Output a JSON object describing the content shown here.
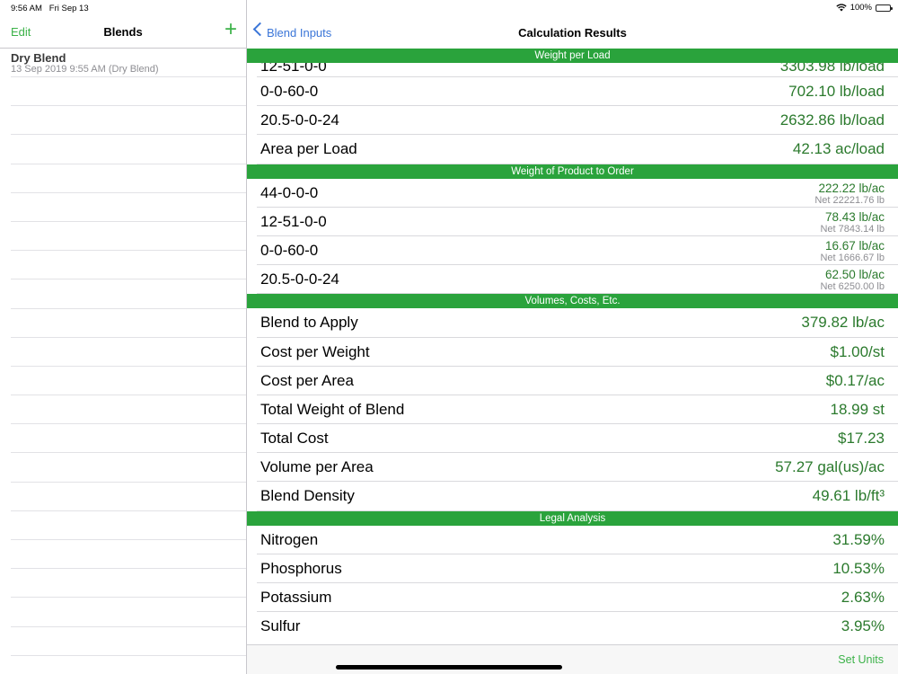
{
  "status": {
    "time": "9:56 AM",
    "date": "Fri Sep 13",
    "battery": "100%"
  },
  "sidebar": {
    "edit_label": "Edit",
    "title": "Blends",
    "add_label": "+",
    "items": [
      {
        "name": "Dry Blend",
        "subtitle": "13 Sep 2019  9:55 AM (Dry Blend)"
      }
    ]
  },
  "detail": {
    "back_label": "Blend Inputs",
    "title": "Calculation Results",
    "toolbar_button": "Set Units"
  },
  "sections": {
    "weight_per_load": {
      "header": "Weight per Load",
      "partial_row": {
        "label": "12-51-0-0",
        "value": "3303.98 lb/load"
      },
      "rows": [
        {
          "label": "0-0-60-0",
          "value": "702.10 lb/load"
        },
        {
          "label": "20.5-0-0-24",
          "value": "2632.86 lb/load"
        },
        {
          "label": "Area per Load",
          "value": "42.13 ac/load"
        }
      ]
    },
    "weight_to_order": {
      "header": "Weight of Product to Order",
      "rows": [
        {
          "label": "44-0-0-0",
          "value": "222.22 lb/ac",
          "net": "Net 22221.76 lb"
        },
        {
          "label": "12-51-0-0",
          "value": "78.43 lb/ac",
          "net": "Net 7843.14 lb"
        },
        {
          "label": "0-0-60-0",
          "value": "16.67 lb/ac",
          "net": "Net 1666.67 lb"
        },
        {
          "label": "20.5-0-0-24",
          "value": "62.50 lb/ac",
          "net": "Net 6250.00 lb"
        }
      ]
    },
    "volumes_costs": {
      "header": "Volumes, Costs, Etc.",
      "rows": [
        {
          "label": "Blend to Apply",
          "value": "379.82 lb/ac"
        },
        {
          "label": "Cost per Weight",
          "value": "$1.00/st"
        },
        {
          "label": "Cost per Area",
          "value": "$0.17/ac"
        },
        {
          "label": "Total Weight of Blend",
          "value": "18.99 st"
        },
        {
          "label": "Total Cost",
          "value": "$17.23"
        },
        {
          "label": "Volume per Area",
          "value": "57.27 gal(us)/ac"
        },
        {
          "label": "Blend Density",
          "value": "49.61 lb/ft³"
        }
      ]
    },
    "legal_analysis": {
      "header": "Legal Analysis",
      "rows": [
        {
          "label": "Nitrogen",
          "value": "31.59%"
        },
        {
          "label": "Phosphorus",
          "value": "10.53%"
        },
        {
          "label": "Potassium",
          "value": "2.63%"
        },
        {
          "label": "Sulfur",
          "value": "3.95%"
        }
      ]
    }
  },
  "colors": {
    "accent_green": "#3cb249",
    "header_green": "#2aa33c",
    "value_green": "#2b7a2d",
    "link_blue": "#3b76d8"
  }
}
